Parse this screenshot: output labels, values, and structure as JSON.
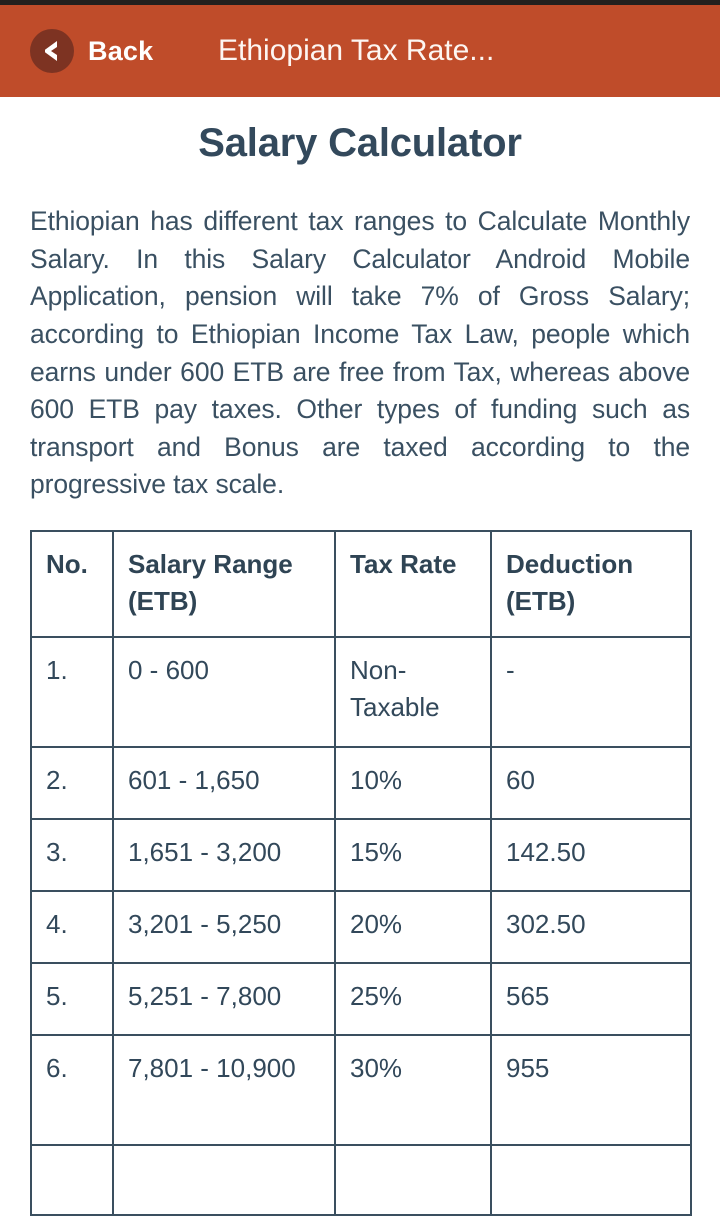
{
  "appbar": {
    "back_label": "Back",
    "title": "Ethiopian Tax Rate...",
    "back_icon": "chevron-left-icon",
    "bg_color": "#bf4c2a",
    "back_circle_color": "#7d3322"
  },
  "page": {
    "title": "Salary Calculator",
    "title_color": "#33495c",
    "intro": "Ethiopian has different tax ranges to Calculate Monthly Salary. In this Salary Calculator Android Mobile Application, pension will take 7% of Gross Salary; according to Ethiopian Income Tax Law, people which earns under 600 ETB are free from Tax, whereas above 600 ETB pay taxes. Other types of funding such as transport and Bonus are taxed according to the progressive tax scale."
  },
  "table": {
    "headers": [
      "No.",
      "Salary Range (ETB)",
      "Tax Rate",
      "Deduction (ETB)"
    ],
    "rows": [
      {
        "no": "1.",
        "range": "0 - 600",
        "rate": "Non-Taxable",
        "deduction": "-"
      },
      {
        "no": "2.",
        "range": "601 - 1,650",
        "rate": "10%",
        "deduction": "60"
      },
      {
        "no": "3.",
        "range": "1,651 - 3,200",
        "rate": "15%",
        "deduction": "142.50"
      },
      {
        "no": "4.",
        "range": "3,201 - 5,250",
        "rate": "20%",
        "deduction": "302.50"
      },
      {
        "no": "5.",
        "range": "5,251 - 7,800",
        "rate": "25%",
        "deduction": "565"
      },
      {
        "no": "6.",
        "range": "7,801 - 10,900",
        "rate": "30%",
        "deduction": "955"
      },
      {
        "no": "",
        "range": "",
        "rate": "",
        "deduction": ""
      }
    ]
  }
}
